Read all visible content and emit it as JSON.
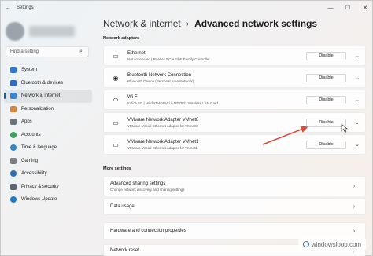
{
  "window": {
    "title": "Settings",
    "back_icon": "back-arrow-icon",
    "controls": [
      "—",
      "☐",
      "✕"
    ]
  },
  "sidebar": {
    "search_placeholder": "Find a setting",
    "items": [
      {
        "label": "System",
        "icon": "system-icon",
        "color": "#2b7bd6"
      },
      {
        "label": "Bluetooth & devices",
        "icon": "bluetooth-icon",
        "color": "#2b6fc4"
      },
      {
        "label": "Network & internet",
        "icon": "network-icon",
        "color": "#3a86d6",
        "active": true
      },
      {
        "label": "Personalization",
        "icon": "brush-icon",
        "color": "#d8843c"
      },
      {
        "label": "Apps",
        "icon": "apps-icon",
        "color": "#6b7680"
      },
      {
        "label": "Accounts",
        "icon": "accounts-icon",
        "color": "#3aa35a"
      },
      {
        "label": "Time & language",
        "icon": "time-language-icon",
        "color": "#2f86c9"
      },
      {
        "label": "Gaming",
        "icon": "gaming-icon",
        "color": "#7b7f85"
      },
      {
        "label": "Accessibility",
        "icon": "accessibility-icon",
        "color": "#2c6fb8"
      },
      {
        "label": "Privacy & security",
        "icon": "shield-icon",
        "color": "#5d6670"
      },
      {
        "label": "Windows Update",
        "icon": "update-icon",
        "color": "#1f7ad1"
      }
    ]
  },
  "main": {
    "breadcrumb_parent": "Network & internet",
    "breadcrumb_sep": "›",
    "breadcrumb_current": "Advanced network settings",
    "section_adapters": "Network adapters",
    "adapters": [
      {
        "name": "Ethernet",
        "desc": "Not connected | Realtek PCIe GbE Family Controller",
        "button": "Disable",
        "icon": "ethernet-icon"
      },
      {
        "name": "Bluetooth Network Connection",
        "desc": "Bluetooth Device (Personal Area Network)",
        "button": "Disable",
        "icon": "bluetooth-network-icon"
      },
      {
        "name": "Wi-Fi",
        "desc": "Indica 5G | MediaTek Wi-Fi 6 MT7921 Wireless LAN Card",
        "button": "Disable",
        "icon": "wifi-icon"
      },
      {
        "name": "VMware Network Adapter VMnet8",
        "desc": "VMware Virtual Ethernet Adapter for VMnet8",
        "button": "Disable",
        "icon": "ethernet-icon"
      },
      {
        "name": "VMware Network Adapter VMnet1",
        "desc": "VMware Virtual Ethernet Adapter for VMnet1",
        "button": "Disable",
        "icon": "ethernet-icon"
      }
    ],
    "section_more": "More settings",
    "more": [
      {
        "name": "Advanced sharing settings",
        "desc": "Change network discovery and sharing settings"
      },
      {
        "name": "Data usage",
        "desc": ""
      },
      {
        "name": "Hardware and connection properties",
        "desc": ""
      },
      {
        "name": "Network reset",
        "desc": ""
      }
    ]
  },
  "annotation": {
    "arrow_color": "#d94a3a"
  },
  "watermark": {
    "text": "windowsloop.com"
  }
}
